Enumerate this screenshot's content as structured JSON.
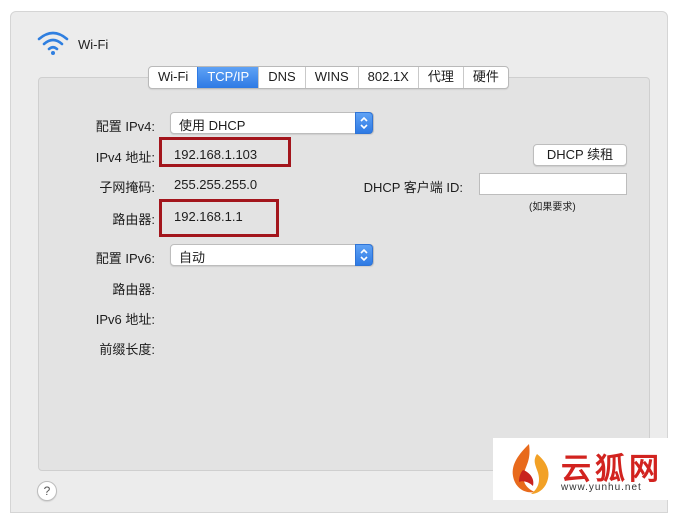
{
  "window": {
    "title": "Wi-Fi"
  },
  "tabs": [
    {
      "label": "Wi-Fi",
      "active": false
    },
    {
      "label": "TCP/IP",
      "active": true
    },
    {
      "label": "DNS",
      "active": false
    },
    {
      "label": "WINS",
      "active": false
    },
    {
      "label": "802.1X",
      "active": false
    },
    {
      "label": "代理",
      "active": false
    },
    {
      "label": "硬件",
      "active": false
    }
  ],
  "ipv4": {
    "config_label": "配置 IPv4:",
    "config_value": "使用 DHCP",
    "address_label": "IPv4 地址:",
    "address_value": "192.168.1.103",
    "subnet_label": "子网掩码:",
    "subnet_value": "255.255.255.0",
    "router_label": "路由器:",
    "router_value": "192.168.1.1",
    "renew_button": "DHCP 续租",
    "client_id_label": "DHCP 客户端 ID:",
    "client_id_value": "",
    "client_id_hint": "(如果要求)"
  },
  "ipv6": {
    "config_label": "配置 IPv6:",
    "config_value": "自动",
    "router_label": "路由器:",
    "address_label": "IPv6 地址:",
    "prefix_label": "前缀长度:"
  },
  "help": {
    "label": "?"
  },
  "watermark": {
    "brand": "云狐网",
    "url": "www.yunhu.net"
  },
  "colors": {
    "accent": "#2e7ae4",
    "highlight_box": "#a3151c",
    "watermark": "#d2231f"
  }
}
